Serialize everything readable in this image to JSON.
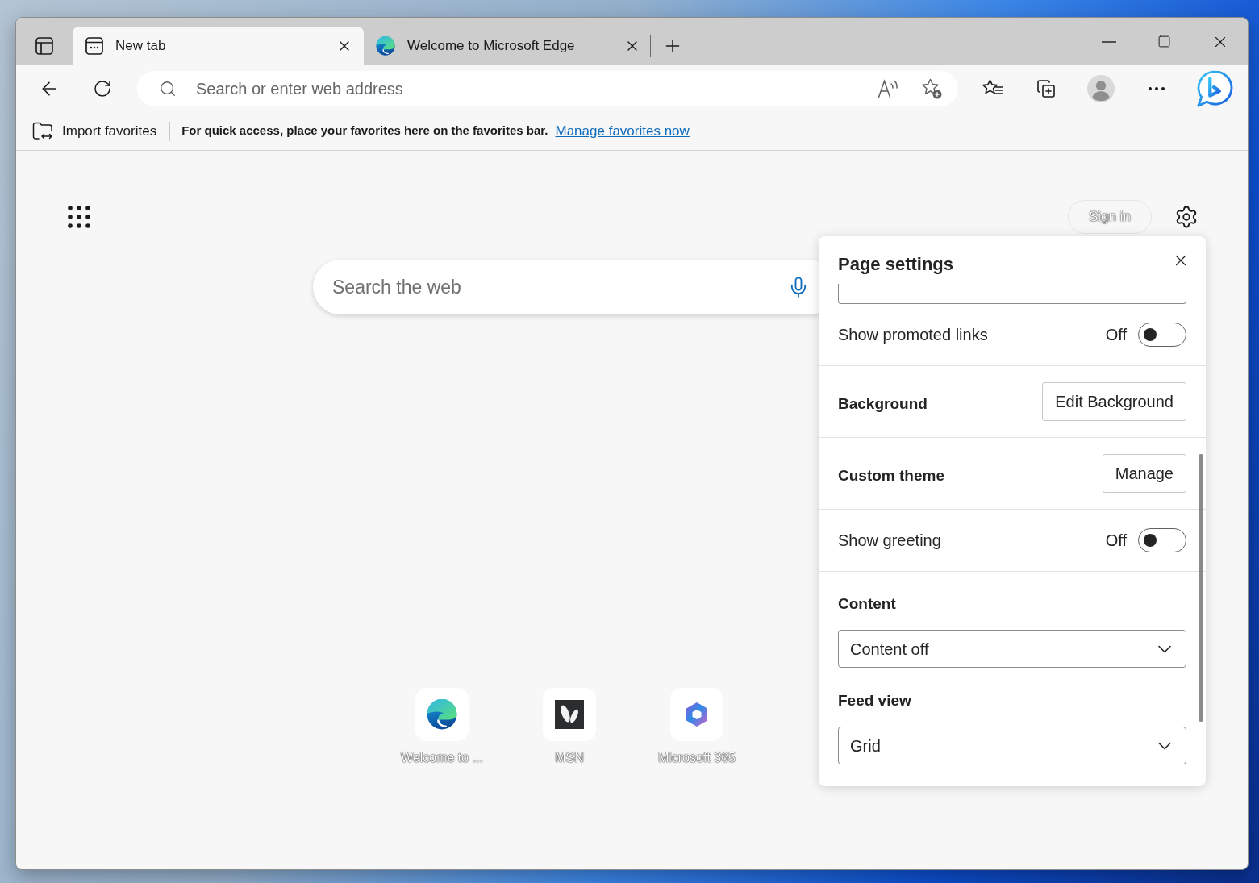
{
  "tabs": [
    {
      "kind": "newtab",
      "title": "New tab",
      "selected": true
    },
    {
      "kind": "edge",
      "title": "Welcome to Microsoft Edge",
      "selected": false
    }
  ],
  "address_bar": {
    "placeholder": "Search or enter web address"
  },
  "favorites_bar": {
    "import_label": "Import favorites",
    "message": "For quick access, place your favorites here on the favorites bar.",
    "link": "Manage favorites now"
  },
  "new_tab_page": {
    "sign_in": "Sign in",
    "search": {
      "placeholder": "Search the web"
    },
    "quick_links": [
      {
        "kind": "edge",
        "label": "Welcome to ..."
      },
      {
        "kind": "msn",
        "label": "MSN"
      },
      {
        "kind": "m365",
        "label": "Microsoft 365"
      }
    ]
  },
  "page_settings": {
    "title": "Page settings",
    "sections": [
      {
        "rows": [
          {
            "kind": "toggle",
            "label": "Show promoted links",
            "state_label": "Off",
            "on": false
          }
        ]
      },
      {
        "rows": [
          {
            "kind": "button",
            "label": "Background",
            "button": "Edit Background"
          }
        ]
      },
      {
        "rows": [
          {
            "kind": "button",
            "label": "Custom theme",
            "button": "Manage"
          }
        ]
      },
      {
        "rows": [
          {
            "kind": "toggle",
            "label": "Show greeting",
            "state_label": "Off",
            "on": false
          }
        ]
      },
      {
        "rows": [
          {
            "kind": "select",
            "label": "Content",
            "value": "Content off"
          },
          {
            "kind": "select",
            "label": "Feed view",
            "value": "Grid"
          }
        ]
      }
    ]
  }
}
